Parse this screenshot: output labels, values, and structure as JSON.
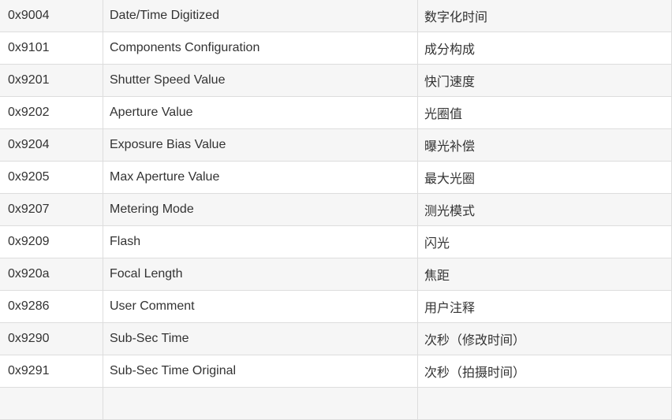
{
  "table": {
    "rows": [
      {
        "tag": "0x9004",
        "name": "Date/Time Digitized",
        "cn": "数字化时间"
      },
      {
        "tag": "0x9101",
        "name": "Components Configuration",
        "cn": "成分构成"
      },
      {
        "tag": "0x9201",
        "name": "Shutter Speed Value",
        "cn": "快门速度"
      },
      {
        "tag": "0x9202",
        "name": "Aperture Value",
        "cn": "光圈值"
      },
      {
        "tag": "0x9204",
        "name": "Exposure Bias Value",
        "cn": "曝光补偿"
      },
      {
        "tag": "0x9205",
        "name": "Max Aperture Value",
        "cn": "最大光圈"
      },
      {
        "tag": "0x9207",
        "name": "Metering Mode",
        "cn": "测光模式"
      },
      {
        "tag": "0x9209",
        "name": "Flash",
        "cn": "闪光"
      },
      {
        "tag": "0x920a",
        "name": "Focal Length",
        "cn": "焦距"
      },
      {
        "tag": "0x9286",
        "name": "User Comment",
        "cn": "用户注释"
      },
      {
        "tag": "0x9290",
        "name": "Sub-Sec Time",
        "cn": "次秒（修改时间）"
      },
      {
        "tag": "0x9291",
        "name": "Sub-Sec Time Original",
        "cn": "次秒（拍摄时间）"
      },
      {
        "tag": "",
        "name": "",
        "cn": ""
      }
    ]
  }
}
